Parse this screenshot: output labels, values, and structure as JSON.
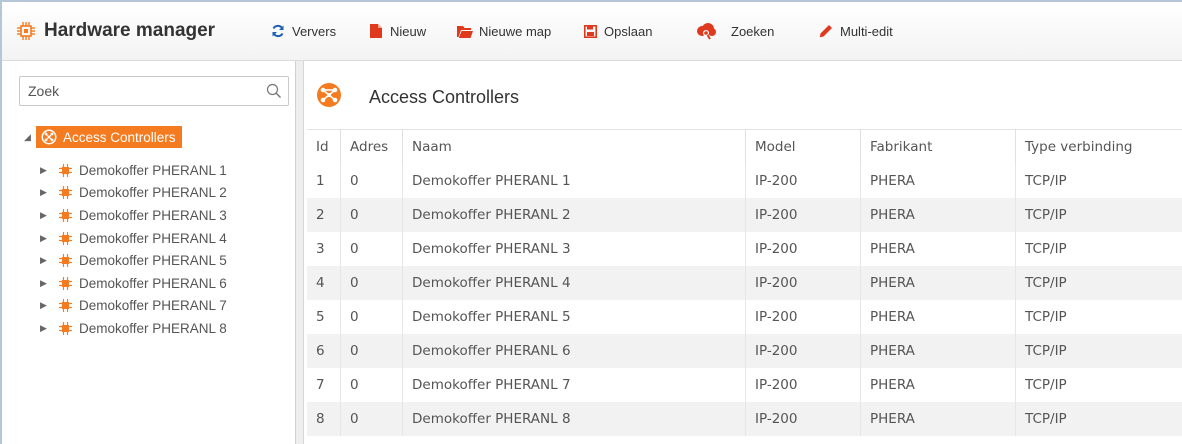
{
  "app": {
    "title": "Hardware manager"
  },
  "toolbar": {
    "refresh": "Ververs",
    "new": "Nieuw",
    "new_folder": "Nieuwe map",
    "save": "Opslaan",
    "search": "Zoeken",
    "multi_edit": "Multi-edit"
  },
  "sidebar": {
    "search_placeholder": "Zoek",
    "root_label": "Access Controllers",
    "items": [
      {
        "label": "Demokoffer PHERANL 1"
      },
      {
        "label": "Demokoffer PHERANL 2"
      },
      {
        "label": "Demokoffer PHERANL 3"
      },
      {
        "label": "Demokoffer PHERANL 4"
      },
      {
        "label": "Demokoffer PHERANL 5"
      },
      {
        "label": "Demokoffer PHERANL 6"
      },
      {
        "label": "Demokoffer PHERANL 7"
      },
      {
        "label": "Demokoffer PHERANL 8"
      }
    ]
  },
  "main": {
    "title": "Access Controllers",
    "columns": [
      "Id",
      "Adres",
      "Naam",
      "Model",
      "Fabrikant",
      "Type verbinding"
    ],
    "rows": [
      [
        "1",
        "0",
        "Demokoffer PHERANL 1",
        "IP-200",
        "PHERA",
        "TCP/IP"
      ],
      [
        "2",
        "0",
        "Demokoffer PHERANL 2",
        "IP-200",
        "PHERA",
        "TCP/IP"
      ],
      [
        "3",
        "0",
        "Demokoffer PHERANL 3",
        "IP-200",
        "PHERA",
        "TCP/IP"
      ],
      [
        "4",
        "0",
        "Demokoffer PHERANL 4",
        "IP-200",
        "PHERA",
        "TCP/IP"
      ],
      [
        "5",
        "0",
        "Demokoffer PHERANL 5",
        "IP-200",
        "PHERA",
        "TCP/IP"
      ],
      [
        "6",
        "0",
        "Demokoffer PHERANL 6",
        "IP-200",
        "PHERA",
        "TCP/IP"
      ],
      [
        "7",
        "0",
        "Demokoffer PHERANL 7",
        "IP-200",
        "PHERA",
        "TCP/IP"
      ],
      [
        "8",
        "0",
        "Demokoffer PHERANL 8",
        "IP-200",
        "PHERA",
        "TCP/IP"
      ]
    ]
  },
  "colors": {
    "accent": "#f47b20",
    "icon_red": "#e03a1e",
    "refresh_blue": "#1f5fb4"
  },
  "icons": {
    "brand": "chip-icon",
    "refresh": "refresh-icon",
    "new": "new-file-icon",
    "new_folder": "folder-icon",
    "save": "save-icon",
    "search": "cloud-search-icon",
    "multi_edit": "pencil-icon",
    "tree_root": "network-icon",
    "tree_item": "chip-icon"
  }
}
